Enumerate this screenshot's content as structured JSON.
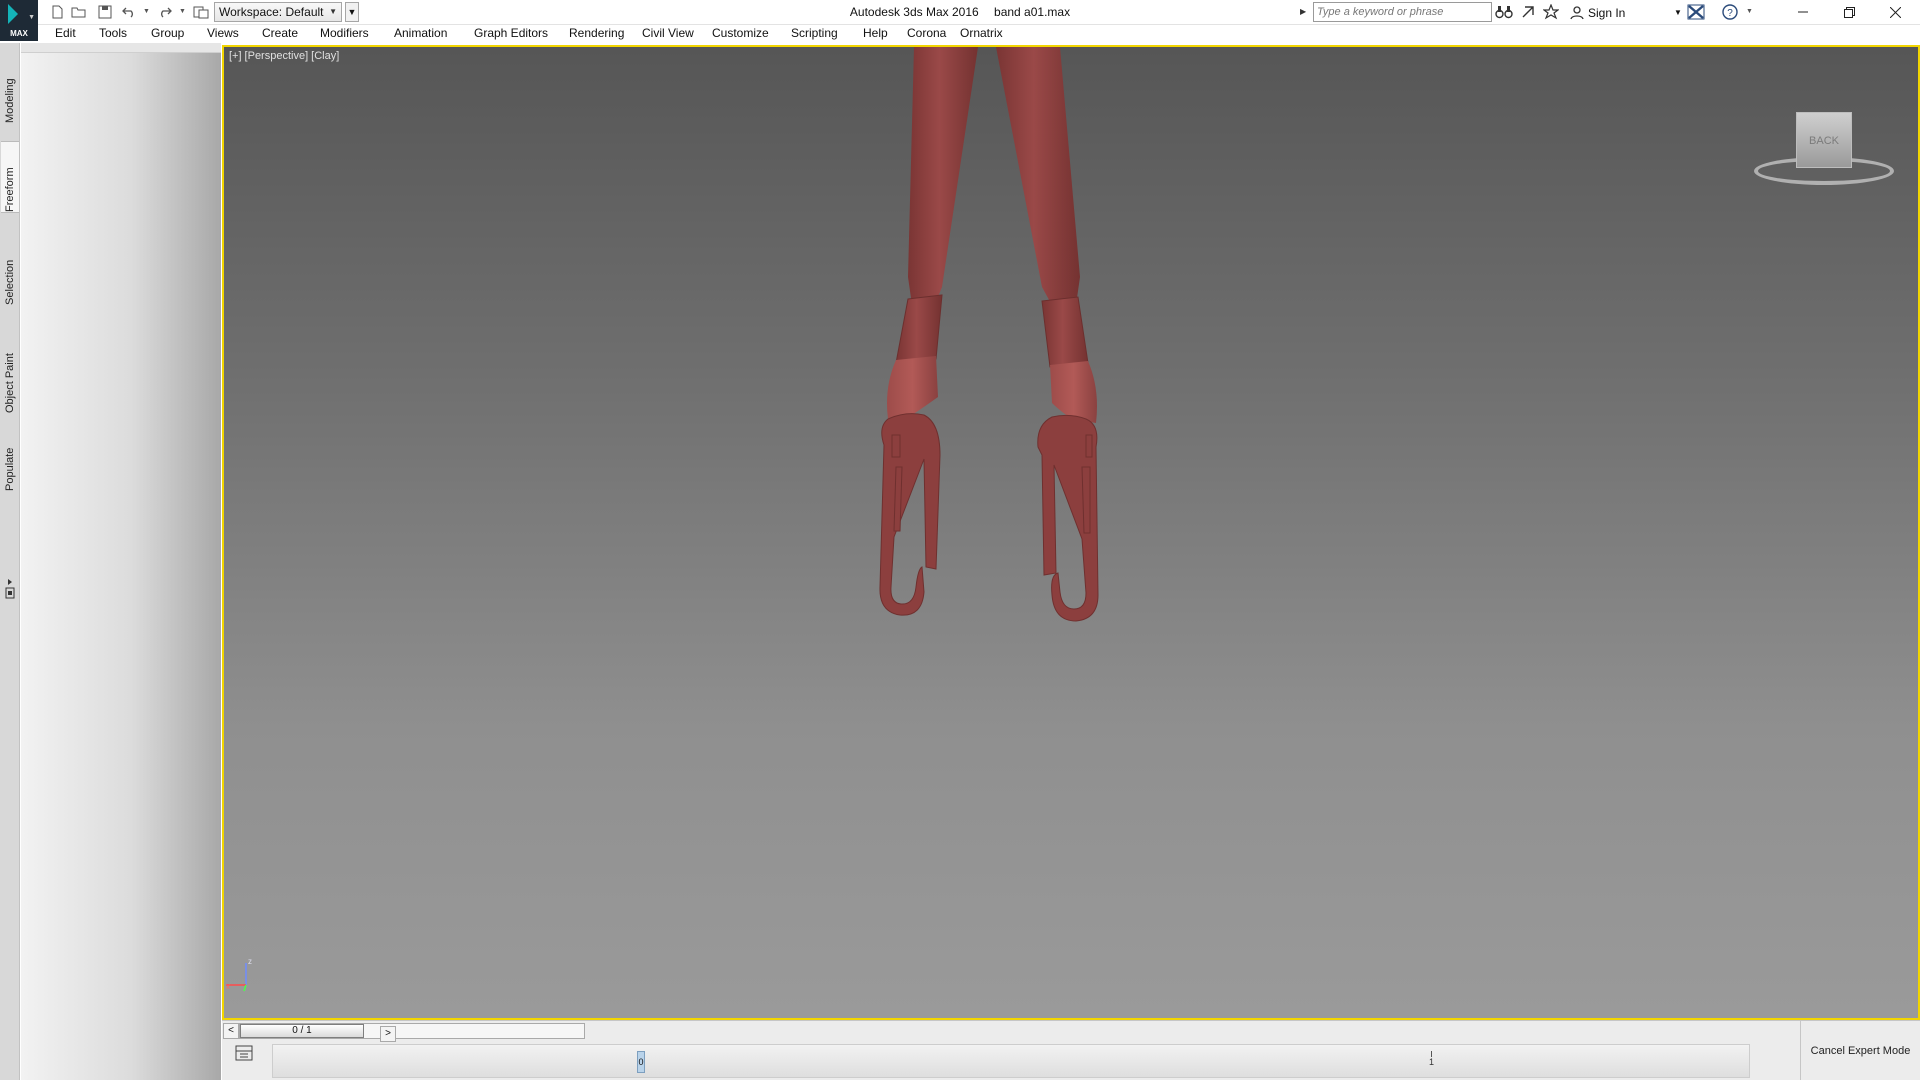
{
  "app": {
    "logo_label": "MAX",
    "title": "Autodesk 3ds Max 2016",
    "file": "band a01.max"
  },
  "quick_access": {
    "workspace_label": "Workspace: Default",
    "icons": [
      "new-file-icon",
      "open-folder-icon",
      "save-icon",
      "undo-icon",
      "redo-icon",
      "project-folder-icon"
    ]
  },
  "search": {
    "placeholder": "Type a keyword or phrase"
  },
  "account": {
    "sign_in": "Sign In"
  },
  "menu": [
    "Edit",
    "Tools",
    "Group",
    "Views",
    "Create",
    "Modifiers",
    "Animation",
    "Graph Editors",
    "Rendering",
    "Civil View",
    "Customize",
    "Scripting",
    "Help",
    "Corona",
    "Ornatrix"
  ],
  "ribbon_tabs": [
    "Modeling",
    "Freeform",
    "Selection",
    "Object Paint",
    "Populate"
  ],
  "ribbon_active_tab": "Freeform",
  "viewport": {
    "labels": [
      "[+]",
      "[Perspective]",
      "[Clay]"
    ],
    "viewcube_face": "BACK",
    "axis_z": "z",
    "axis_x": "x",
    "model_color": "#8c3f3e",
    "border_color": "#f2d500"
  },
  "timeline": {
    "frame_display": "0 / 1",
    "prev": "<",
    "next": ">",
    "marker": "0",
    "end_frame": "1"
  },
  "cancel_expert_mode": "Cancel Expert Mode"
}
